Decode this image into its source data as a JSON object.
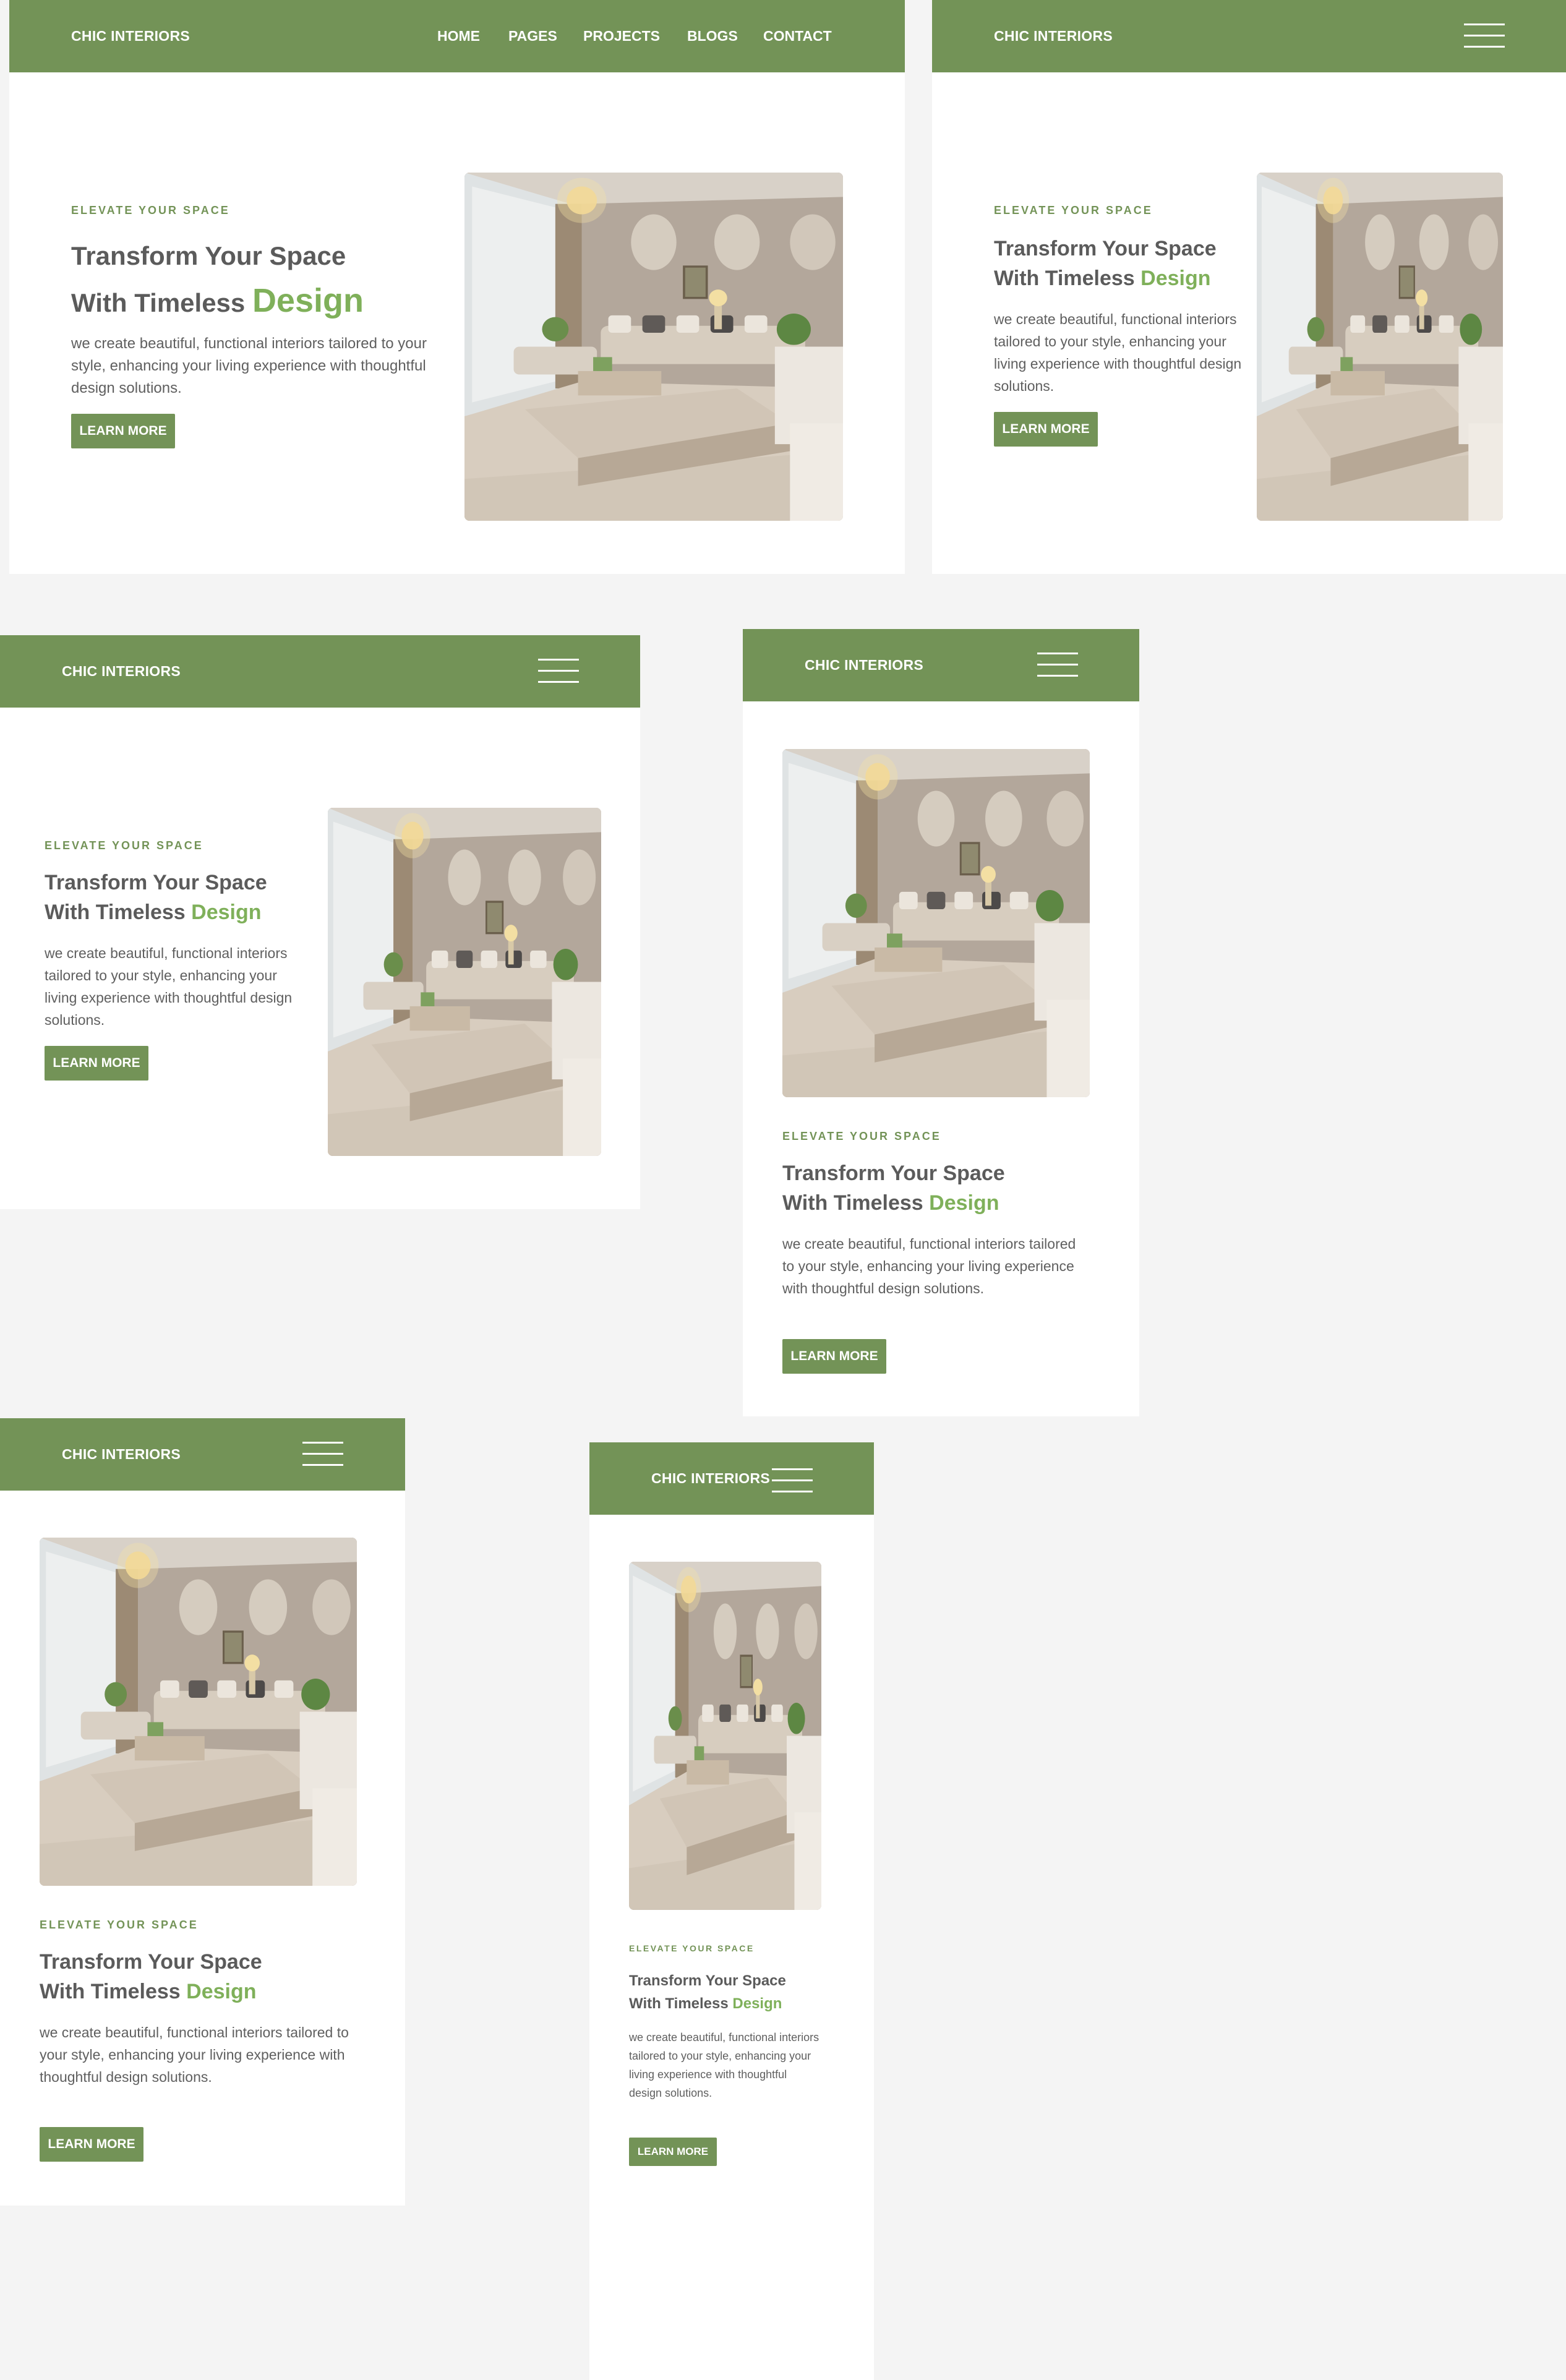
{
  "brand": "CHIC INTERIORS",
  "nav": [
    "HOME",
    "PAGES",
    "PROJECTS",
    "BLOGS",
    "CONTACT"
  ],
  "hero": {
    "eyebrow": "ELEVATE YOUR SPACE",
    "title_line1": "Transform Your Space",
    "title_line2": "With Timeless",
    "title_accent": "Design",
    "description": "we create beautiful, functional interiors tailored to your style, enhancing your living experience with thoughtful design solutions.",
    "button": "LEARN MORE",
    "image": "living-room-photo"
  },
  "icons": {
    "menu": "hamburger-menu-icon"
  },
  "colors": {
    "brand_green": "#739357",
    "accent_green": "#7fb05a",
    "text_gray": "#5b5b5b",
    "page_bg": "#f4f4f4"
  }
}
